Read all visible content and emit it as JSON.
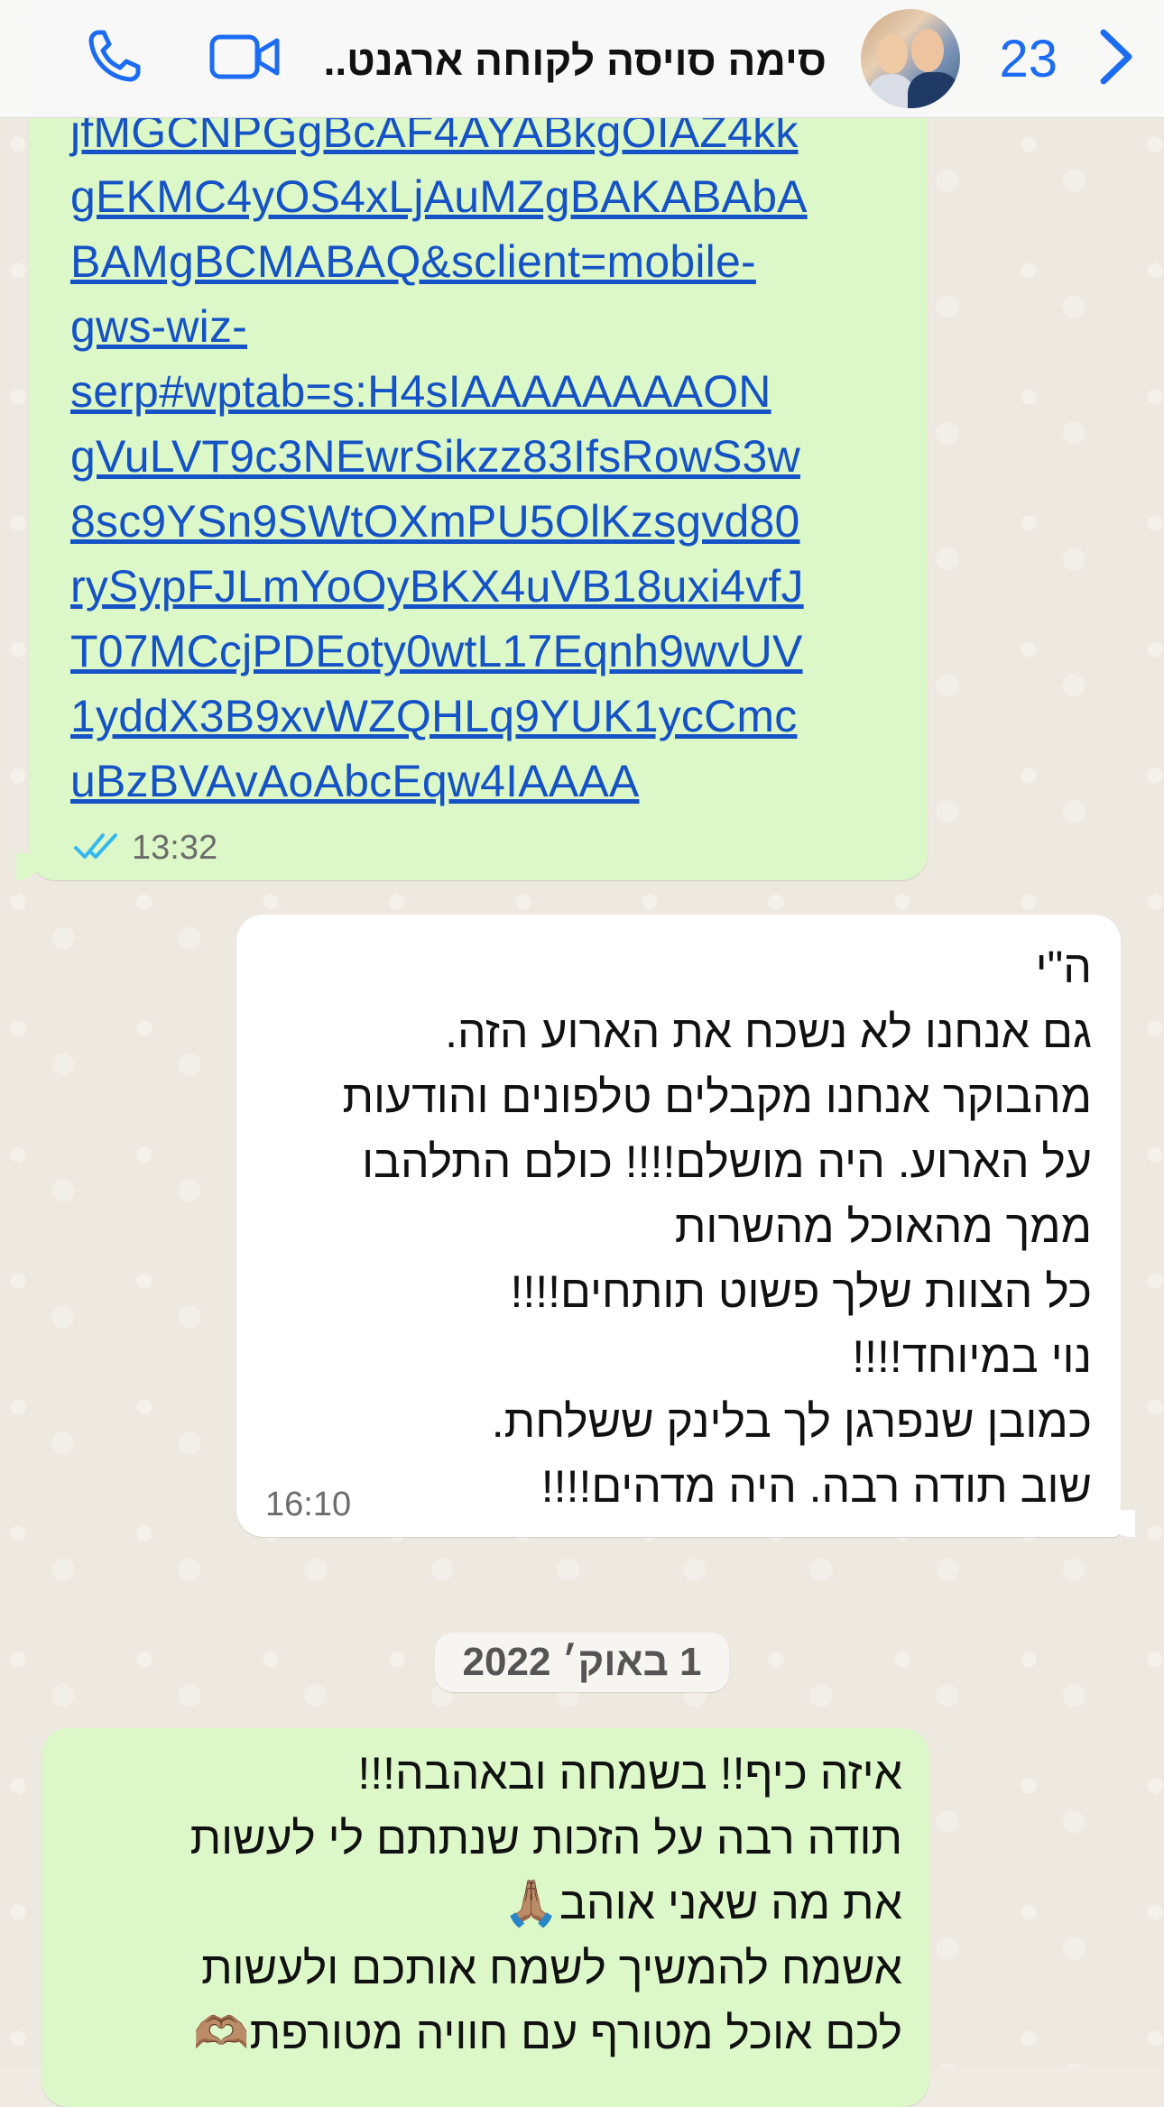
{
  "header": {
    "back_icon": "chevron-left-icon",
    "unread_count": "23",
    "contact_name": "סימה סויסה לקוחה ארגנט...",
    "video_icon": "video-camera-icon",
    "call_icon": "phone-icon"
  },
  "colors": {
    "accent": "#1b6cf2",
    "outgoing_bubble": "#dcf8c8",
    "incoming_bubble": "#ffffff",
    "link": "#1452c5",
    "read_ticks": "#34b7f1"
  },
  "messages": [
    {
      "direction": "outgoing",
      "link_lines": [
        "jfMGCNPGgBcAF4AYABkgOIAZ4kk",
        "gEKMC4yOS4xLjAuMZgBAKABAbA",
        "BAMgBCMABAQ&sclient=mobile-",
        "gws-wiz-",
        "serp#wptab=s:H4sIAAAAAAAAON",
        "gVuLVT9c3NEwrSikzz83IfsRowS3w",
        "8sc9YSn9SWtOXmPU5OlKzsgvd80",
        "rySypFJLmYoOyBKX4uVB18uxi4vfJ",
        "T07MCcjPDEoty0wtL17Eqnh9wvUV",
        "1yddX3B9xvWZQHLq9YUK1ycCmc",
        "uBzBVAvAoAbcEqw4IAAAA"
      ],
      "time": "13:32",
      "status_icon": "double-check-read-icon"
    },
    {
      "direction": "incoming",
      "lines": [
        "ה\"י",
        "גם אנחנו לא נשכח את הארוע הזה.",
        "מהבוקר אנחנו מקבלים טלפונים והודעות",
        "על הארוע. היה מושלם!!!! כולם התלהבו",
        "ממך מהאוכל מהשרות",
        "כל הצוות שלך פשוט תותחים!!!!",
        "נוי במיוחד!!!!",
        "כמובן שנפרגן לך בלינק ששלחת.",
        "שוב תודה רבה. היה מדהים!!!!"
      ],
      "time": "16:10"
    },
    {
      "direction": "outgoing",
      "lines": [
        "איזה כיף!! בשמחה ובאהבה!!!",
        "תודה רבה על הזכות שנתתם לי לעשות",
        "את מה שאני אוהב🙏🏽",
        "אשמח להמשיך לשמח אותכם ולעשות",
        "לכם אוכל מטורף עם חוויה מטורפת🫶🏽"
      ]
    }
  ],
  "date_separator": "1 באוק׳ 2022"
}
